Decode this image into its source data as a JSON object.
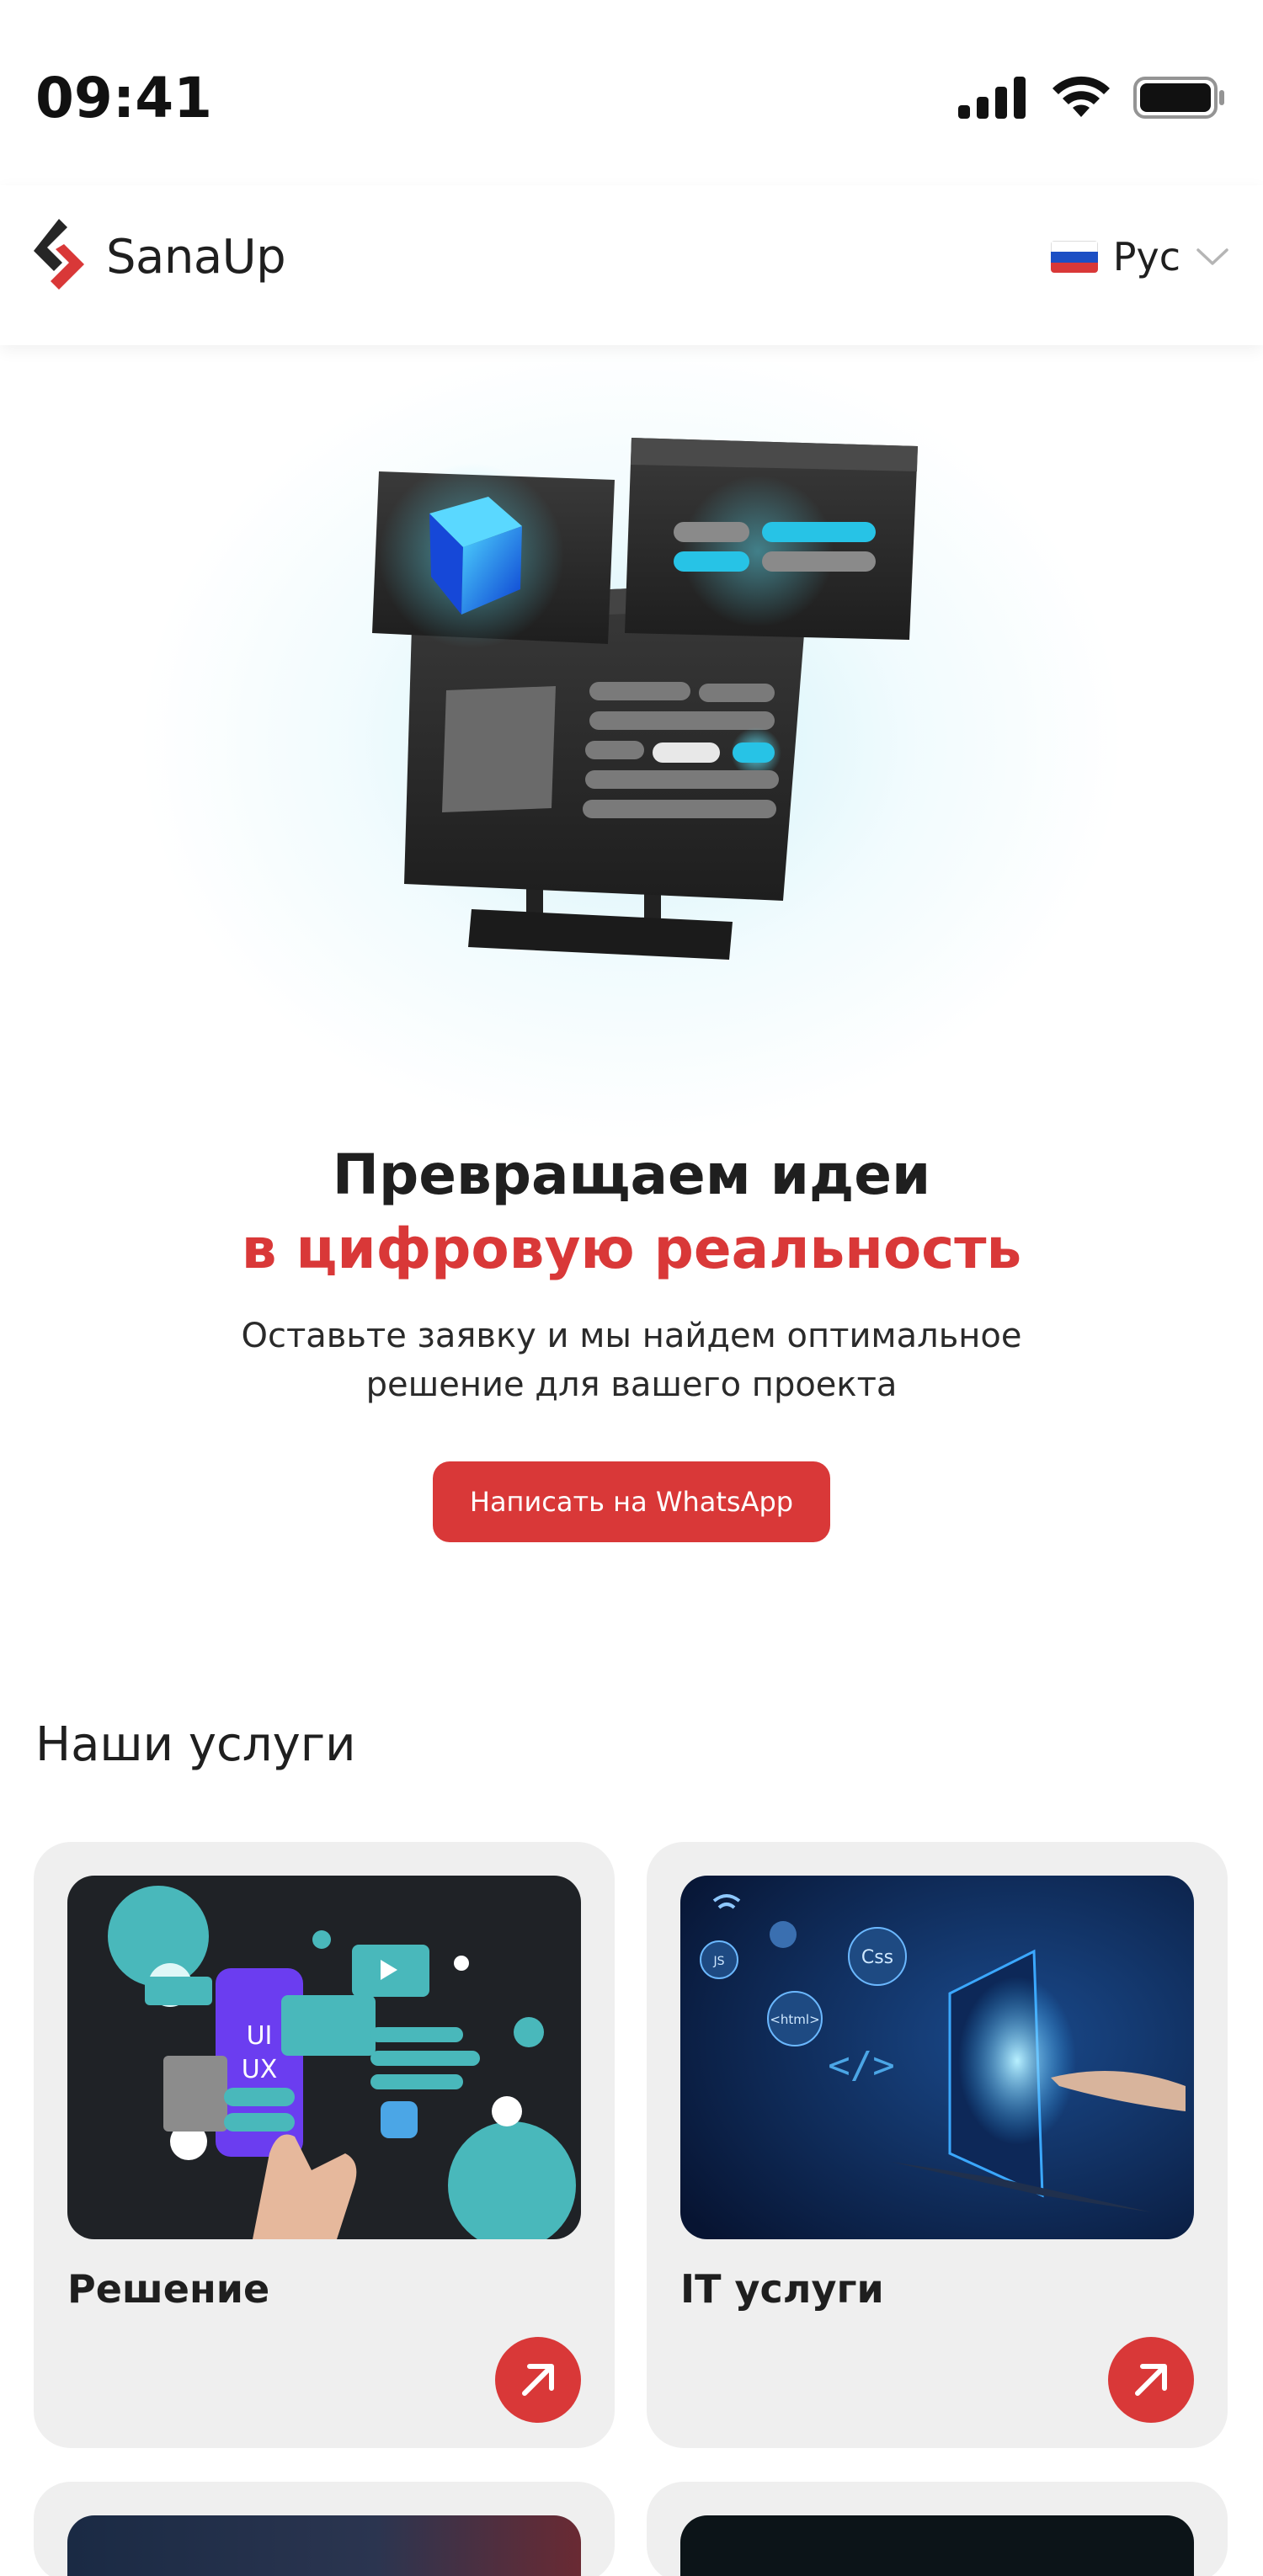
{
  "status_bar": {
    "time": "09:41"
  },
  "header": {
    "logo_text": "SanaUp",
    "language": "Рус",
    "language_flag": "russia-flag-icon"
  },
  "hero": {
    "title_line1": "Превращаем идеи",
    "title_line2": "в цифровую реальность",
    "subtitle_line1": "Оставьте заявку и мы найдем оптимальное",
    "subtitle_line2": "решение для вашего проекта",
    "cta_label": "Написать на WhatsApp"
  },
  "services": {
    "title": "Наши услуги",
    "cards": [
      {
        "title": "Решение"
      },
      {
        "title": "IT услуги"
      }
    ]
  },
  "colors": {
    "accent": "#d93838",
    "card_bg": "#efefef",
    "text": "#1f1f1f"
  }
}
